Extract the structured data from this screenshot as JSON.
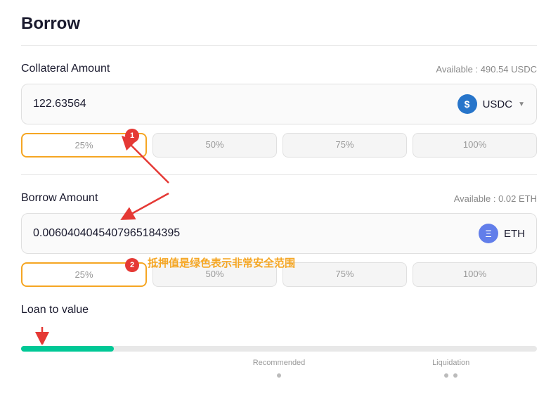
{
  "page": {
    "title": "Borrow"
  },
  "collateral": {
    "label": "Collateral Amount",
    "available_label": "Available :",
    "available_amount": "490.54",
    "available_token": "USDC",
    "input_value": "122.63564",
    "token": "USDC",
    "percentages": [
      "25%",
      "50%",
      "75%",
      "100%"
    ]
  },
  "borrow": {
    "label": "Borrow Amount",
    "available_label": "Available :",
    "available_amount": "0.02",
    "available_token": "ETH",
    "input_value": "0.0060404045407965184395",
    "token": "ETH",
    "percentages": [
      "25%",
      "50%",
      "75%",
      "100%"
    ]
  },
  "ltv": {
    "label": "Loan to value",
    "recommended_label": "Recommended",
    "liquidation_label": "Liquidation",
    "fill_percent": 18,
    "annotation_text": "抵押值是绿色表示非常安全范围"
  },
  "badges": {
    "badge1": "1",
    "badge2": "2"
  }
}
